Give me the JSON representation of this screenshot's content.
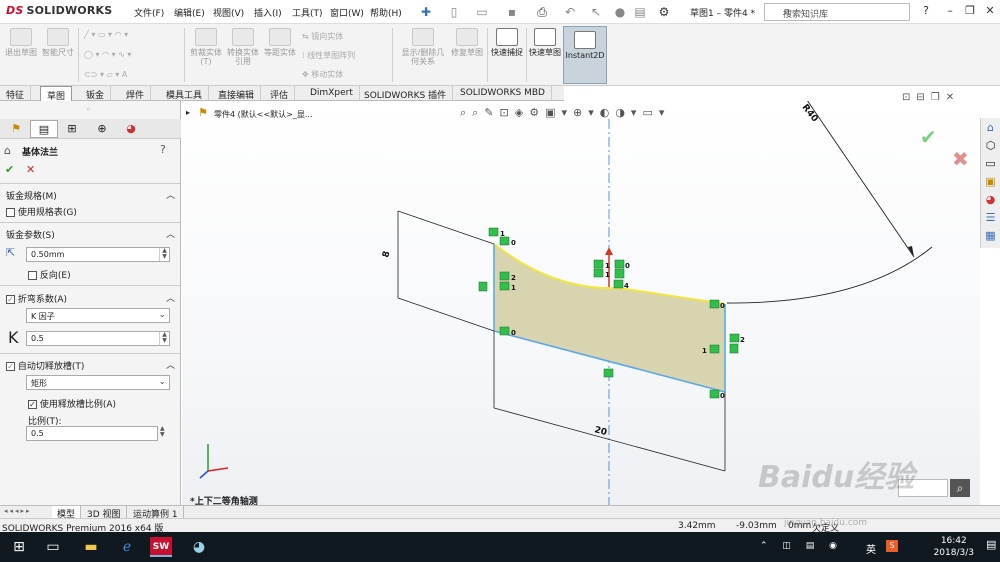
{
  "app": {
    "brand": "SOLIDWORKS",
    "doc_title": "草图1 – 零件4 *",
    "search_placeholder": "搜索知识库"
  },
  "menu": [
    "文件(F)",
    "编辑(E)",
    "视图(V)",
    "插入(I)",
    "工具(T)",
    "窗口(W)",
    "帮助(H)"
  ],
  "ribbon": {
    "exit_sketch": "退出草图",
    "smart_dim": "智能尺寸",
    "trim": "剪裁实体(T)",
    "convert": "转换实体引用",
    "offset": "等距实体",
    "mirror": "镜向实体",
    "linear_pattern": "线性草图阵列",
    "move": "移动实体",
    "display_relations": "显示/删除几何关系",
    "repair": "修复草图",
    "quick_snap": "快速捕捉",
    "rapid_sketch": "快速草图",
    "instant2d": "Instant2D"
  },
  "tabs": [
    "特征",
    "草图",
    "钣金",
    "焊件",
    "模具工具",
    "直接编辑",
    "评估",
    "DimXpert",
    "SOLIDWORKS 插件",
    "SOLIDWORKS MBD"
  ],
  "active_tab": "草图",
  "property_manager": {
    "title": "基体法兰",
    "sheet_gauge": {
      "label": "钣金规格(M)",
      "use_gauge_table": "使用规格表(G)"
    },
    "sheet_params": {
      "label": "钣金参数(S)",
      "thickness": "0.50mm",
      "reverse": "反向(E)"
    },
    "bend_allowance": {
      "label": "折弯系数(A)",
      "type": "K 因子",
      "k_symbol": "K",
      "k_value": "0.5"
    },
    "relief": {
      "label": "自动切释放槽(T)",
      "type": "矩形",
      "use_ratio": "使用释放槽比例(A)",
      "ratio_label": "比例(T):",
      "ratio_value": "0.5"
    }
  },
  "graphics": {
    "tree_item": "零件4  (默认<<默认>_显...",
    "view_label": "*上下二等角轴测",
    "dimensions": {
      "width": "20",
      "height": "8",
      "radius": "R40"
    },
    "relation_labels": [
      "1",
      "0",
      "2",
      "1",
      "0",
      "1",
      "0",
      "1",
      "4",
      "0",
      "0",
      "1",
      "2",
      "0"
    ]
  },
  "model_tabs": [
    "模型",
    "3D 视图",
    "运动算例 1"
  ],
  "status": {
    "edition": "SOLIDWORKS Premium 2016 x64 版",
    "x": "3.42mm",
    "y": "-9.03mm",
    "z": "0mm",
    "state": "欠定义"
  },
  "taskbar": {
    "time": "16:42",
    "date": "2018/3/3",
    "ime": "英"
  },
  "watermark": {
    "text": "Baidu经验",
    "url": "jingyan.baidu.com"
  }
}
